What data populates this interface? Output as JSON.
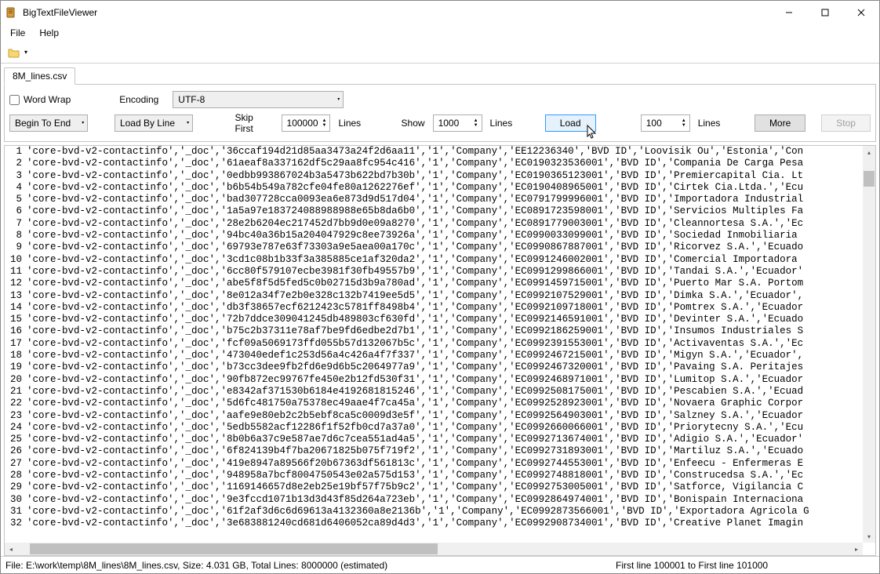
{
  "app": {
    "title": "BigTextFileViewer"
  },
  "menu": {
    "file": "File",
    "help": "Help"
  },
  "tab": {
    "name": "8M_lines.csv"
  },
  "opts": {
    "word_wrap_label": "Word Wrap",
    "encoding_label": "Encoding",
    "encoding_value": "UTF-8",
    "direction": "Begin To End",
    "mode": "Load By Line",
    "skip_first_label": "Skip First",
    "skip_first_value": "100000",
    "lines_label": "Lines",
    "show_label": "Show",
    "show_value": "1000",
    "load_label": "Load",
    "more_value": "100",
    "more_label": "More",
    "stop_label": "Stop"
  },
  "status": {
    "left": "File: E:\\work\\temp\\8M_lines\\8M_lines.csv, Size:   4.031 GB, Total Lines: 8000000 (estimated)",
    "right": "First line 100001 to First line 101000"
  },
  "lines": [
    "'core-bvd-v2-contactinfo','_doc','36ccaf194d21d85aa3473a24f2d6aa11','1','Company','EE12236340','BVD ID','Loovisik Ou','Estonia','Con",
    "'core-bvd-v2-contactinfo','_doc','61aeaf8a337162df5c29aa8fc954c416','1','Company','EC0190323536001','BVD ID','Compania De Carga Pesa",
    "'core-bvd-v2-contactinfo','_doc','0edbb993867024b3a5473b622bd7b30b','1','Company','EC0190365123001','BVD ID','Premiercapital Cia. Lt",
    "'core-bvd-v2-contactinfo','_doc','b6b54b549a782cfe04fe80a1262276ef','1','Company','EC0190408965001','BVD ID','Cirtek Cia.Ltda.','Ecu",
    "'core-bvd-v2-contactinfo','_doc','bad307728cca0093ea6e873d9d517d04','1','Company','EC0791799996001','BVD ID','Importadora Industrial",
    "'core-bvd-v2-contactinfo','_doc','1a5a97e183724088988988e65b8da6b0','1','Company','EC0891723598001','BVD ID','Servicios Multiples Fa",
    "'core-bvd-v2-contactinfo','_doc','28e2b6204ec217452d7bb9d0e09a8270','1','Company','EC0891779003001','BVD ID','Cleannortesa S.A.','Ec",
    "'core-bvd-v2-contactinfo','_doc','94bc40a36b15a204047929c8ee73926a','1','Company','EC0990033099001','BVD ID','Sociedad Inmobiliaria ",
    "'core-bvd-v2-contactinfo','_doc','69793e787e63f73303a9e5aea00a170c','1','Company','EC0990867887001','BVD ID','Ricorvez S.A.','Ecuado",
    "'core-bvd-v2-contactinfo','_doc','3cd1c08b1b33f3a385885ce1af320da2','1','Company','EC0991246002001','BVD ID','Comercial Importadora ",
    "'core-bvd-v2-contactinfo','_doc','6cc80f579107ecbe3981f30fb49557b9','1','Company','EC0991299866001','BVD ID','Tandai S.A.','Ecuador'",
    "'core-bvd-v2-contactinfo','_doc','abe5f8f5d5fed5c0b02715d3b9a780ad','1','Company','EC0991459715001','BVD ID','Puerto Mar S.A. Portom",
    "'core-bvd-v2-contactinfo','_doc','8e012a34f7e2b0e328c132b7419ee5d5','1','Company','EC0992107529001','BVD ID','Dimka S.A.','Ecuador',",
    "'core-bvd-v2-contactinfo','_doc','db3f38657ecf6212423c5781ff8498b4','1','Company','EC0992109718001','BVD ID','Pomtrex S.A.','Ecuador",
    "'core-bvd-v2-contactinfo','_doc','72b7ddce309041245db489803cf630fd','1','Company','EC0992146591001','BVD ID','Devinter S.A.','Ecuado",
    "'core-bvd-v2-contactinfo','_doc','b75c2b37311e78af7be9fd6edbe2d7b1','1','Company','EC0992186259001','BVD ID','Insumos Industriales S",
    "'core-bvd-v2-contactinfo','_doc','fcf09a5069173ffd055b57d132067b5c','1','Company','EC0992391553001','BVD ID','Activaventas S.A.','Ec",
    "'core-bvd-v2-contactinfo','_doc','473040edef1c253d56a4c426a4f7f337','1','Company','EC0992467215001','BVD ID','Migyn S.A.','Ecuador',",
    "'core-bvd-v2-contactinfo','_doc','b73cc3dee9fb2fd6e9d6b5c2064977a9','1','Company','EC0992467320001','BVD ID','Pavaing S.A. Peritajes",
    "'core-bvd-v2-contactinfo','_doc','90fb872ec99767fe450e2b12fd530f31','1','Company','EC0992468971001','BVD ID','Lumitop S.A.','Ecuador",
    "'core-bvd-v2-contactinfo','_doc','e8342af371530b6184e4192681815246','1','Company','EC0992508175001','BVD ID','Pescabien S.A.','Ecuad",
    "'core-bvd-v2-contactinfo','_doc','5d6fc481750a75378ec49aae4f7ca45a','1','Company','EC0992528923001','BVD ID','Novaera Graphic Corpor",
    "'core-bvd-v2-contactinfo','_doc','aafe9e80eb2c2b5ebf8ca5c0009d3e5f','1','Company','EC0992564903001','BVD ID','Salzney S.A.','Ecuador",
    "'core-bvd-v2-contactinfo','_doc','5edb5582acf12286f1f52fb0cd7a37a0','1','Company','EC0992660066001','BVD ID','Priorytecny S.A.','Ecu",
    "'core-bvd-v2-contactinfo','_doc','8b0b6a37c9e587ae7d6c7cea551ad4a5','1','Company','EC0992713674001','BVD ID','Adigio S.A.','Ecuador'",
    "'core-bvd-v2-contactinfo','_doc','6f824139b4f7ba20671825b075f719f2','1','Company','EC0992731893001','BVD ID','Martiluz S.A.','Ecuado",
    "'core-bvd-v2-contactinfo','_doc','419e8947a89566f20b67363df561813c','1','Company','EC0992744553001','BVD ID','Enfeecu - Enfermeras E",
    "'core-bvd-v2-contactinfo','_doc','948958a7bcf8004750543e02a575d153','1','Company','EC0992748818001','BVD ID','Construcedsa S.A.','Ec",
    "'core-bvd-v2-contactinfo','_doc','1169146657d8e2eb25e19bf57f75b9c2','1','Company','EC0992753005001','BVD ID','Satforce, Vigilancia C",
    "'core-bvd-v2-contactinfo','_doc','9e3fccd1071b13d3d43f85d264a723eb','1','Company','EC0992864974001','BVD ID','Bonispain Internaciona",
    "'core-bvd-v2-contactinfo','_doc','61f2af3d6c6d69613a4132360a8e2136b','1','Company','EC0992873566001','BVD ID','Exportadora Agricola G",
    "'core-bvd-v2-contactinfo','_doc','3e683881240cd681d6406052ca89d4d3','1','Company','EC0992908734001','BVD ID','Creative Planet Imagin"
  ]
}
